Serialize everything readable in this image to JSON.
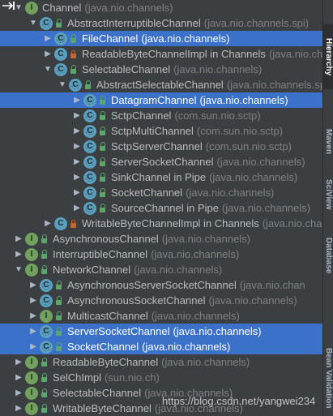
{
  "hierarchy_tree": {
    "rows": [
      {
        "depth": 0,
        "expanded": true,
        "kind": "interface",
        "vis": "none",
        "name": "Channel",
        "pkg": "(java.nio.channels)"
      },
      {
        "depth": 1,
        "expanded": true,
        "kind": "class-abstract",
        "vis": "unlocked",
        "name": "AbstractInterruptibleChannel",
        "pkg": "(java.nio.channels.spi)"
      },
      {
        "depth": 2,
        "expanded": false,
        "kind": "class-abstract",
        "vis": "unlocked",
        "name": "FileChannel",
        "pkg": "(java.nio.channels)",
        "selected": true
      },
      {
        "depth": 2,
        "expanded": false,
        "kind": "class",
        "vis": "locked",
        "name": "ReadableByteChannelImpl in Channels",
        "pkg": "(java.nio.channels)"
      },
      {
        "depth": 2,
        "expanded": true,
        "kind": "class-abstract",
        "vis": "unlocked",
        "name": "SelectableChannel",
        "pkg": "(java.nio.channels)"
      },
      {
        "depth": 3,
        "expanded": true,
        "kind": "class-abstract",
        "vis": "unlocked",
        "name": "AbstractSelectableChannel",
        "pkg": "(java.nio.channels.spi)"
      },
      {
        "depth": 4,
        "expanded": false,
        "kind": "class-abstract",
        "vis": "unlocked",
        "name": "DatagramChannel",
        "pkg": "(java.nio.channels)",
        "selected": true
      },
      {
        "depth": 4,
        "expanded": false,
        "kind": "class-abstract",
        "vis": "unlocked",
        "name": "SctpChannel",
        "pkg": "(com.sun.nio.sctp)"
      },
      {
        "depth": 4,
        "expanded": false,
        "kind": "class-abstract",
        "vis": "unlocked",
        "name": "SctpMultiChannel",
        "pkg": "(com.sun.nio.sctp)"
      },
      {
        "depth": 4,
        "expanded": false,
        "kind": "class-abstract",
        "vis": "unlocked",
        "name": "SctpServerChannel",
        "pkg": "(com.sun.nio.sctp)"
      },
      {
        "depth": 4,
        "expanded": false,
        "kind": "class-abstract",
        "vis": "unlocked",
        "name": "ServerSocketChannel",
        "pkg": "(java.nio.channels)"
      },
      {
        "depth": 4,
        "expanded": false,
        "kind": "class-abstract",
        "vis": "unlocked",
        "name": "SinkChannel in Pipe",
        "pkg": "(java.nio.channels)"
      },
      {
        "depth": 4,
        "expanded": false,
        "kind": "class-abstract",
        "vis": "unlocked",
        "name": "SocketChannel",
        "pkg": "(java.nio.channels)"
      },
      {
        "depth": 4,
        "expanded": false,
        "kind": "class-abstract",
        "vis": "unlocked",
        "name": "SourceChannel in Pipe",
        "pkg": "(java.nio.channels)"
      },
      {
        "depth": 2,
        "expanded": false,
        "kind": "class",
        "vis": "locked",
        "name": "WritableByteChannelImpl in Channels",
        "pkg": "(java.nio.cha"
      },
      {
        "depth": 0,
        "expanded": false,
        "kind": "interface",
        "vis": "unlocked",
        "name": "AsynchronousChannel",
        "pkg": "(java.nio.channels)"
      },
      {
        "depth": 0,
        "expanded": false,
        "kind": "interface",
        "vis": "unlocked",
        "name": "InterruptibleChannel",
        "pkg": "(java.nio.channels)"
      },
      {
        "depth": 0,
        "expanded": true,
        "kind": "interface",
        "vis": "unlocked",
        "name": "NetworkChannel",
        "pkg": "(java.nio.channels)"
      },
      {
        "depth": 1,
        "expanded": false,
        "kind": "class-abstract",
        "vis": "unlocked",
        "name": "AsynchronousServerSocketChannel",
        "pkg": "(java.nio.chan"
      },
      {
        "depth": 1,
        "expanded": false,
        "kind": "class-abstract",
        "vis": "unlocked",
        "name": "AsynchronousSocketChannel",
        "pkg": "(java.nio.channels)"
      },
      {
        "depth": 1,
        "expanded": false,
        "kind": "interface",
        "vis": "unlocked",
        "name": "MulticastChannel",
        "pkg": "(java.nio.channels)"
      },
      {
        "depth": 1,
        "expanded": false,
        "kind": "class-abstract",
        "vis": "unlocked",
        "name": "ServerSocketChannel",
        "pkg": "(java.nio.channels)",
        "selected": true
      },
      {
        "depth": 1,
        "expanded": false,
        "kind": "class-abstract",
        "vis": "unlocked",
        "name": "SocketChannel",
        "pkg": "(java.nio.channels)",
        "selected": true
      },
      {
        "depth": 0,
        "expanded": false,
        "kind": "interface",
        "vis": "unlocked",
        "name": "ReadableByteChannel",
        "pkg": "(java.nio.channels)"
      },
      {
        "depth": 0,
        "expanded": false,
        "kind": "interface",
        "vis": "unlocked",
        "name": "SelChImpl",
        "pkg": "(sun.nio.ch)"
      },
      {
        "depth": 0,
        "expanded": false,
        "kind": "interface",
        "vis": "unlocked",
        "name": "SelectableChannel",
        "pkg": "(java.nio.channels)"
      },
      {
        "depth": 0,
        "expanded": false,
        "kind": "interface",
        "vis": "unlocked",
        "name": "WritableByteChannel",
        "pkg": "(java.nio.channels)"
      }
    ]
  },
  "right_sidebar": {
    "tabs": [
      {
        "label": "Hierarchy",
        "icon": "hierarchy-icon",
        "active": true
      },
      {
        "label": "Maven",
        "icon": "maven-icon",
        "active": false
      },
      {
        "label": "SciView",
        "icon": "sciview-icon",
        "active": false
      },
      {
        "label": "Database",
        "icon": "database-icon",
        "active": false
      },
      {
        "label": "Bean Validation",
        "icon": "bean-validation-icon",
        "active": false
      }
    ]
  },
  "watermark": {
    "text": "https://blog.csdn.net/yangwei234"
  },
  "colors": {
    "background": "#3c3f41",
    "selection": "#3b71c9",
    "class_icon": "#5b9fbf",
    "interface_icon": "#71a15c",
    "text": "#bbbbbb",
    "package_text": "#808080"
  }
}
